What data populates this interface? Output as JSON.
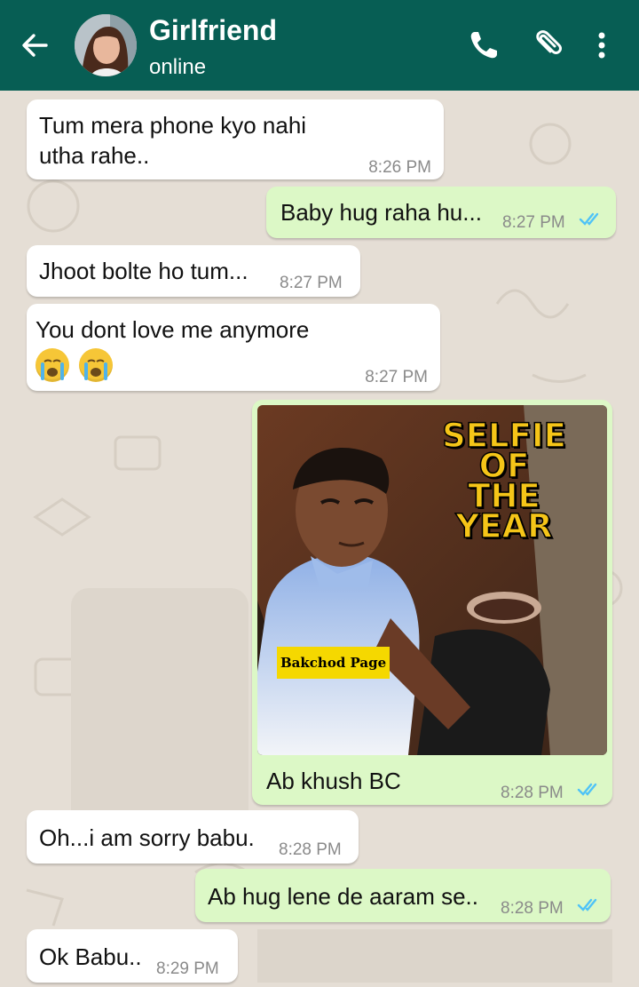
{
  "header": {
    "contact_name": "Girlfriend",
    "status": "online",
    "icons": [
      "back-arrow-icon",
      "phone-icon",
      "paperclip-icon",
      "more-vertical-icon"
    ]
  },
  "colors": {
    "header_bg": "#075e54",
    "outgoing_bubble": "#dcf8c6",
    "incoming_bubble": "#ffffff",
    "read_ticks": "#4fc3f7",
    "chat_bg": "#e5ded5"
  },
  "messages": [
    {
      "direction": "incoming",
      "text": "Tum mera phone kyo nahi\nutha rahe..",
      "time": "8:26 PM"
    },
    {
      "direction": "outgoing",
      "text": "Baby hug raha hu...",
      "time": "8:27 PM",
      "status": "read"
    },
    {
      "direction": "incoming",
      "text": "Jhoot bolte ho tum...",
      "time": "8:27 PM"
    },
    {
      "direction": "incoming",
      "text": "You dont love me anymore",
      "emoji": [
        "crying-face-emoji",
        "crying-face-emoji"
      ],
      "time": "8:27 PM"
    },
    {
      "direction": "outgoing",
      "type": "image",
      "image": {
        "overlay_title": "SELFIE\nOF\nTHE\nYEAR",
        "watermark": "Bakchod Page"
      },
      "caption": "Ab khush BC",
      "time": "8:28 PM",
      "status": "read"
    },
    {
      "direction": "incoming",
      "text": "Oh...i am sorry babu.",
      "time": "8:28 PM"
    },
    {
      "direction": "outgoing",
      "text": "Ab hug lene de aaram se..",
      "time": "8:28 PM",
      "status": "read"
    },
    {
      "direction": "incoming",
      "text": "Ok Babu..",
      "time": "8:29 PM"
    }
  ]
}
